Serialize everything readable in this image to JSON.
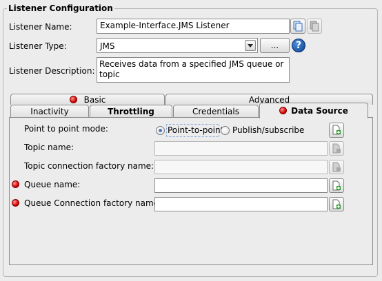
{
  "section": {
    "title": "Listener Configuration"
  },
  "fields": {
    "name": {
      "label": "Listener Name:",
      "value": "Example-Interface.JMS Listener"
    },
    "type": {
      "label": "Listener Type:",
      "value": "JMS",
      "browse_label": "..."
    },
    "description": {
      "label": "Listener Description:",
      "value": "Receives data from a specified JMS queue or topic"
    }
  },
  "help_icon": "?",
  "tabs_row1": [
    {
      "label": "Basic",
      "has_error": true
    },
    {
      "label": "Advanced",
      "has_error": false
    }
  ],
  "tabs_row2": [
    {
      "label": "Inactivity"
    },
    {
      "label": "Throttling"
    },
    {
      "label": "Credentials"
    },
    {
      "label": "Data Source",
      "has_error": true,
      "selected": true
    }
  ],
  "data_source": {
    "mode_label": "Point to point mode:",
    "mode_options": [
      "Point-to-point",
      "Publish/subscribe"
    ],
    "mode_selected": "Point-to-point",
    "topic_name": {
      "label": "Topic name:",
      "value": "",
      "enabled": false
    },
    "topic_cf": {
      "label": "Topic connection factory name:",
      "value": "",
      "enabled": false
    },
    "queue_name": {
      "label": "Queue name:",
      "value": "",
      "required": true
    },
    "queue_cf": {
      "label": "Queue Connection factory name:",
      "value": "",
      "required": true
    }
  },
  "icons": {
    "copy": "copy-icon",
    "paste": "paste-icon",
    "new_doc": "new-document-icon",
    "help": "help-icon",
    "error": "error-indicator-icon"
  }
}
